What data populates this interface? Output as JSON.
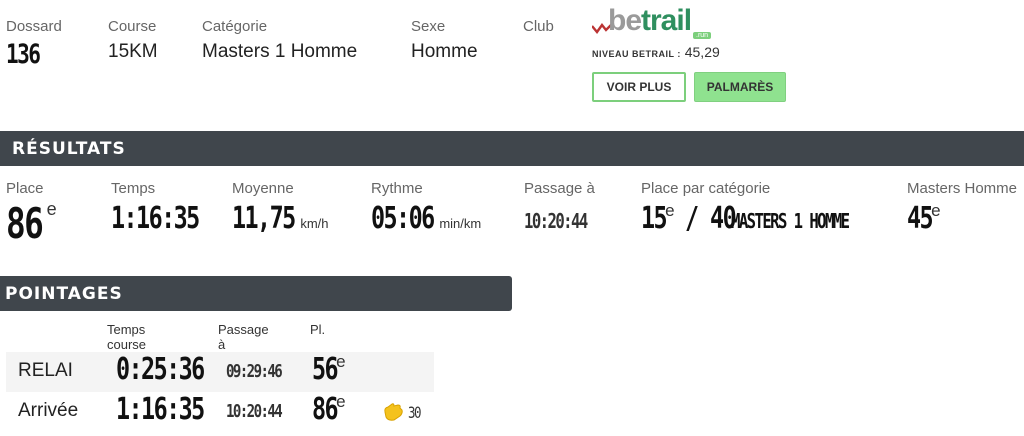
{
  "info": {
    "dossard_label": "Dossard",
    "dossard_value": "136",
    "course_label": "Course",
    "course_value": "15KM",
    "categorie_label": "Catégorie",
    "categorie_value": "Masters 1 Homme",
    "sexe_label": "Sexe",
    "sexe_value": "Homme",
    "club_label": "Club"
  },
  "betrail": {
    "logo_be": "be",
    "logo_trail": "trail",
    "logo_run": ".run",
    "niveau_label": "NIVEAU BETRAIL :",
    "niveau_value": "45,29",
    "voir_plus": "VOIR PLUS",
    "palmares": "PALMARÈS",
    "accent_color": "#2f8f5f",
    "button_green": "#8fe28f"
  },
  "results": {
    "title": "RÉSULTATS",
    "place_label": "Place",
    "place_value": "86",
    "place_sup": "e",
    "temps_label": "Temps",
    "temps_value": "1:16:35",
    "moyenne_label": "Moyenne",
    "moyenne_value": "11,75",
    "moyenne_unit": "km/h",
    "rythme_label": "Rythme",
    "rythme_value": "05:06",
    "rythme_unit": "min/km",
    "passage_label": "Passage à",
    "passage_value": "10:20:44",
    "cat_label": "Place par catégorie",
    "cat_place": "15",
    "cat_sup": "e",
    "cat_total": "/ 40",
    "cat_name": "MASTERS 1 HOMME",
    "masters_label": "Masters Homme",
    "masters_value": "45",
    "masters_sup": "e"
  },
  "pointages": {
    "title": "POINTAGES",
    "headers": [
      "Temps course",
      "Passage à",
      "Pl."
    ],
    "rows": [
      {
        "name": "RELAI",
        "time": "0:25:36",
        "passage": "09:29:46",
        "place": "56",
        "sup": "e"
      },
      {
        "name": "Arrivée",
        "time": "1:16:35",
        "passage": "10:20:44",
        "place": "86",
        "sup": "e",
        "cheers": "30"
      }
    ]
  }
}
